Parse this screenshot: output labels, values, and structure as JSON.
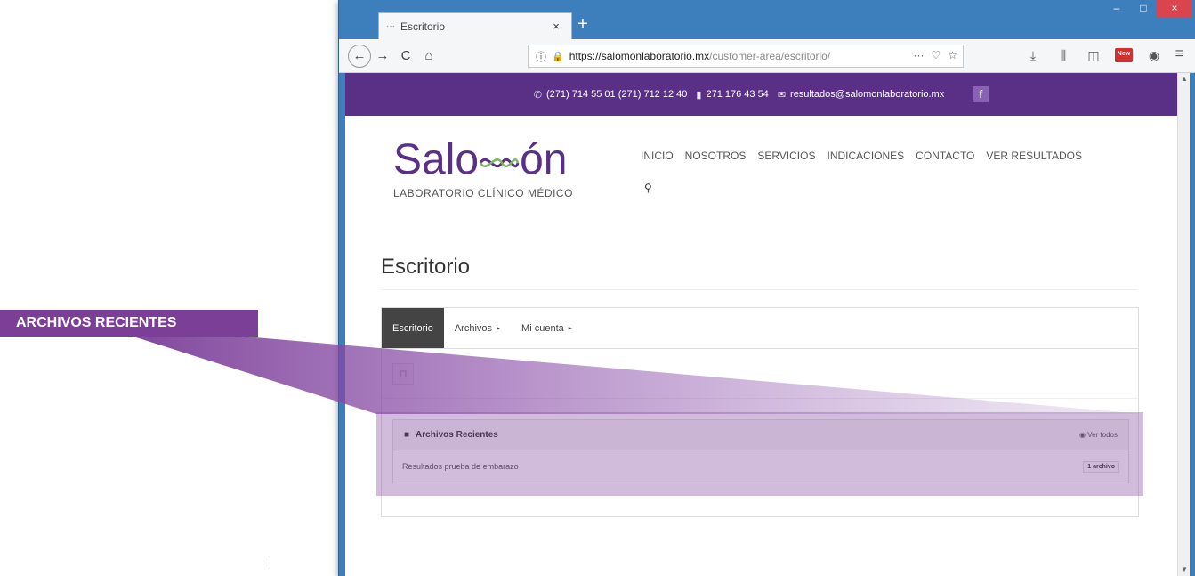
{
  "callout": {
    "label": "ARCHIVOS RECIENTES"
  },
  "browser": {
    "tab_title": "Escritorio",
    "tab_favicon": "···",
    "tab_close": "×",
    "new_tab": "+",
    "window_controls": {
      "minimize": "–",
      "maximize": "□",
      "close": "×"
    },
    "nav": {
      "back": "←",
      "forward": "→",
      "reload": "C",
      "home": "⌂"
    },
    "url": {
      "host": "https://salomonlaboratorio.mx",
      "path": "/customer-area/escritorio/",
      "actions": [
        "···",
        "♡",
        "☆"
      ]
    },
    "toolbar_icons": [
      "download-icon",
      "library-icon",
      "sidebar-icon",
      "extension-icon",
      "account-icon"
    ],
    "menu": "≡",
    "badge_text": "New"
  },
  "site": {
    "topbar": {
      "phones": "(271) 714 55 01 (271) 712 12 40",
      "mobile": "271 176 43 54",
      "email": "resultados@salomonlaboratorio.mx",
      "facebook": "f"
    },
    "logo": {
      "left": "Salo",
      "right": "ón",
      "subtitle": "LABORATORIO CLÍNICO MÉDICO"
    },
    "nav_items": [
      "INICIO",
      "NOSOTROS",
      "SERVICIOS",
      "INDICACIONES",
      "CONTACTO",
      "VER RESULTADOS"
    ],
    "search_glyph": "⚲",
    "accent_color": "#5a2f86"
  },
  "page": {
    "title": "Escritorio",
    "tabs": [
      {
        "label": "Escritorio",
        "caret": ""
      },
      {
        "label": "Archivos",
        "caret": "▸"
      },
      {
        "label": "Mi cuenta",
        "caret": "▸"
      }
    ],
    "folder_glyph": "⊓",
    "recent": {
      "title": "Archivos Recientes",
      "view_all": "◉ Ver todos",
      "rows": [
        {
          "name": "Resultados prueba de embarazo",
          "count": "1 archivo"
        }
      ]
    }
  }
}
